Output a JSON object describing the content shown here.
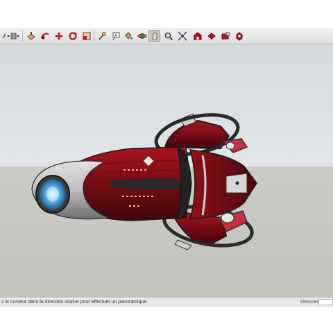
{
  "toolbar": {
    "tools": [
      {
        "name": "paint-dropdown-icon"
      },
      {
        "name": "push-pull-dropdown-icon"
      },
      {
        "name": "push-pull-icon"
      },
      {
        "name": "follow-me-icon"
      },
      {
        "name": "move-icon"
      },
      {
        "name": "rotate-icon"
      },
      {
        "name": "scale-icon"
      },
      {
        "name": "tape-measure-icon"
      },
      {
        "name": "text-icon"
      },
      {
        "name": "paint-bucket-icon"
      },
      {
        "name": "orbit-icon"
      },
      {
        "name": "pan-icon",
        "active": true
      },
      {
        "name": "zoom-icon"
      },
      {
        "name": "zoom-extents-icon"
      },
      {
        "name": "warehouse-icon"
      },
      {
        "name": "share-model-icon"
      },
      {
        "name": "extension-warehouse-icon"
      },
      {
        "name": "extension-manager-icon"
      }
    ]
  },
  "status": {
    "message": "z le curseur dans la direction voulue pour effectuer un panoramique.",
    "measure_label": "Mesures",
    "measure_value": ""
  },
  "colors": {
    "hull_red": "#8e0f18",
    "hull_dark": "#3a080c",
    "silver": "#c9c9c9",
    "engine_glow": "#62b9ef",
    "ring_dark": "#2a2a2a"
  }
}
